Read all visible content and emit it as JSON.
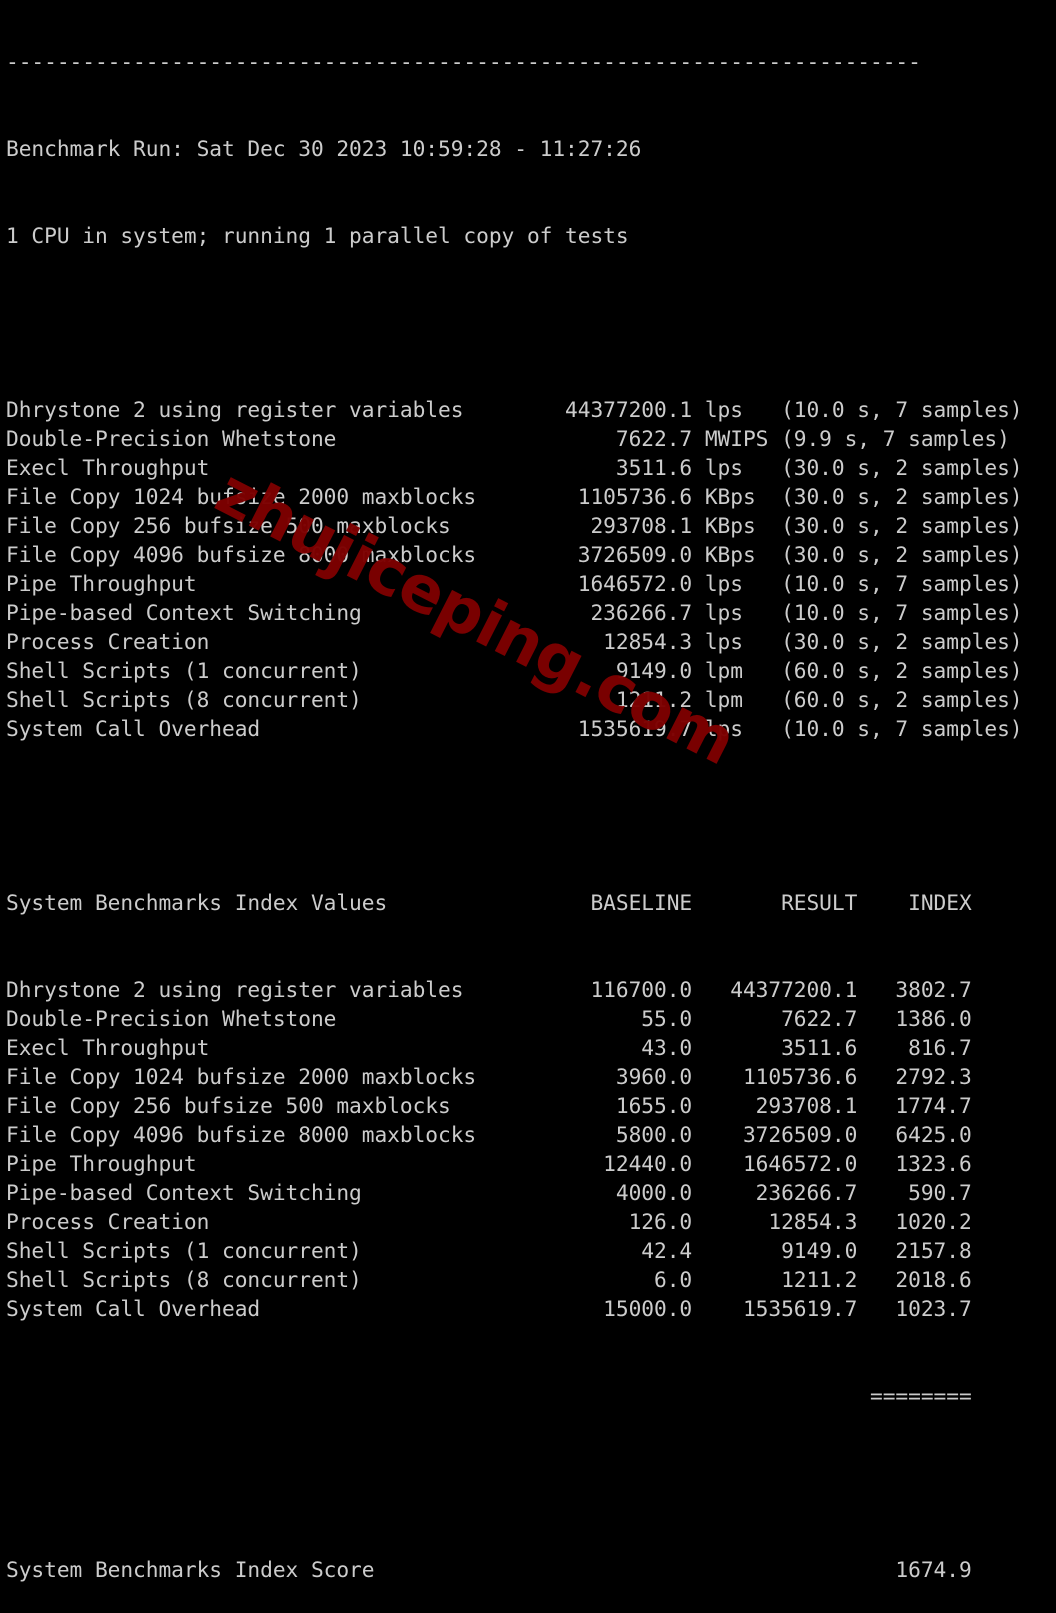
{
  "terminal": {
    "separator": "------------------------------------------------------------------------",
    "run_line": "Benchmark Run: Sat Dec 30 2023 10:59:28 - 11:27:26",
    "cpu_line": "1 CPU in system; running 1 parallel copy of tests",
    "results": [
      {
        "name": "Dhrystone 2 using register variables",
        "value": "44377200.1",
        "unit": "lps",
        "detail": "(10.0 s, 7 samples)"
      },
      {
        "name": "Double-Precision Whetstone",
        "value": "7622.7",
        "unit": "MWIPS",
        "detail": "(9.9 s, 7 samples)"
      },
      {
        "name": "Execl Throughput",
        "value": "3511.6",
        "unit": "lps",
        "detail": "(30.0 s, 2 samples)"
      },
      {
        "name": "File Copy 1024 bufsize 2000 maxblocks",
        "value": "1105736.6",
        "unit": "KBps",
        "detail": "(30.0 s, 2 samples)"
      },
      {
        "name": "File Copy 256 bufsize 500 maxblocks",
        "value": "293708.1",
        "unit": "KBps",
        "detail": "(30.0 s, 2 samples)"
      },
      {
        "name": "File Copy 4096 bufsize 8000 maxblocks",
        "value": "3726509.0",
        "unit": "KBps",
        "detail": "(30.0 s, 2 samples)"
      },
      {
        "name": "Pipe Throughput",
        "value": "1646572.0",
        "unit": "lps",
        "detail": "(10.0 s, 7 samples)"
      },
      {
        "name": "Pipe-based Context Switching",
        "value": "236266.7",
        "unit": "lps",
        "detail": "(10.0 s, 7 samples)"
      },
      {
        "name": "Process Creation",
        "value": "12854.3",
        "unit": "lps",
        "detail": "(30.0 s, 2 samples)"
      },
      {
        "name": "Shell Scripts (1 concurrent)",
        "value": "9149.0",
        "unit": "lpm",
        "detail": "(60.0 s, 2 samples)"
      },
      {
        "name": "Shell Scripts (8 concurrent)",
        "value": "1211.2",
        "unit": "lpm",
        "detail": "(60.0 s, 2 samples)"
      },
      {
        "name": "System Call Overhead",
        "value": "1535619.7",
        "unit": "lps",
        "detail": "(10.0 s, 7 samples)"
      }
    ],
    "index_header": {
      "title": "System Benchmarks Index Values",
      "baseline": "BASELINE",
      "result": "RESULT",
      "index": "INDEX"
    },
    "index_rows": [
      {
        "name": "Dhrystone 2 using register variables",
        "baseline": "116700.0",
        "result": "44377200.1",
        "index": "3802.7"
      },
      {
        "name": "Double-Precision Whetstone",
        "baseline": "55.0",
        "result": "7622.7",
        "index": "1386.0"
      },
      {
        "name": "Execl Throughput",
        "baseline": "43.0",
        "result": "3511.6",
        "index": "816.7"
      },
      {
        "name": "File Copy 1024 bufsize 2000 maxblocks",
        "baseline": "3960.0",
        "result": "1105736.6",
        "index": "2792.3"
      },
      {
        "name": "File Copy 256 bufsize 500 maxblocks",
        "baseline": "1655.0",
        "result": "293708.1",
        "index": "1774.7"
      },
      {
        "name": "File Copy 4096 bufsize 8000 maxblocks",
        "baseline": "5800.0",
        "result": "3726509.0",
        "index": "6425.0"
      },
      {
        "name": "Pipe Throughput",
        "baseline": "12440.0",
        "result": "1646572.0",
        "index": "1323.6"
      },
      {
        "name": "Pipe-based Context Switching",
        "baseline": "4000.0",
        "result": "236266.7",
        "index": "590.7"
      },
      {
        "name": "Process Creation",
        "baseline": "126.0",
        "result": "12854.3",
        "index": "1020.2"
      },
      {
        "name": "Shell Scripts (1 concurrent)",
        "baseline": "42.4",
        "result": "9149.0",
        "index": "2157.8"
      },
      {
        "name": "Shell Scripts (8 concurrent)",
        "baseline": "6.0",
        "result": "1211.2",
        "index": "2018.6"
      },
      {
        "name": "System Call Overhead",
        "baseline": "15000.0",
        "result": "1535619.7",
        "index": "1023.7"
      }
    ],
    "score_rule": "========",
    "score_label": "System Benchmarks Index Score",
    "score_value": "1674.9"
  },
  "watermark": "zhujiceping.com",
  "colors": {
    "background": "#000000",
    "text": "#cccccc",
    "watermark": "#7d0000"
  }
}
